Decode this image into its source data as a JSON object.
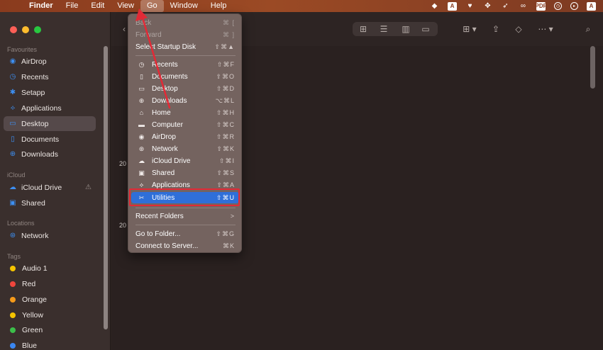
{
  "menubar": {
    "apple": "",
    "items": [
      "Finder",
      "File",
      "Edit",
      "View",
      "Go",
      "Window",
      "Help"
    ],
    "active_item": "Go",
    "tray": [
      "bird-icon",
      "A",
      "heart-icon",
      "shuffle-icon",
      "send-icon",
      "binoculars-icon",
      "PDF",
      "clock-icon",
      "play-icon",
      "A"
    ]
  },
  "sidebar": {
    "favourites_label": "Favourites",
    "favourites": [
      {
        "label": "AirDrop",
        "icon": "airdrop-icon"
      },
      {
        "label": "Recents",
        "icon": "clock-icon"
      },
      {
        "label": "Setapp",
        "icon": "setapp-icon"
      },
      {
        "label": "Applications",
        "icon": "applications-icon"
      },
      {
        "label": "Desktop",
        "icon": "desktop-icon",
        "selected": true
      },
      {
        "label": "Documents",
        "icon": "document-icon"
      },
      {
        "label": "Downloads",
        "icon": "download-icon"
      }
    ],
    "icloud_label": "iCloud",
    "icloud": [
      {
        "label": "iCloud Drive",
        "icon": "cloud-icon",
        "warning": "⚠"
      },
      {
        "label": "Shared",
        "icon": "shared-folder-icon"
      }
    ],
    "locations_label": "Locations",
    "locations": [
      {
        "label": "Network",
        "icon": "globe-icon"
      }
    ],
    "tags_label": "Tags",
    "tags": [
      {
        "label": "Audio 1",
        "color": "#f5c400"
      },
      {
        "label": "Red",
        "color": "#f0463d"
      },
      {
        "label": "Orange",
        "color": "#f59a1a"
      },
      {
        "label": "Yellow",
        "color": "#f5c400"
      },
      {
        "label": "Green",
        "color": "#3cbf4a"
      },
      {
        "label": "Blue",
        "color": "#3a86f0"
      }
    ]
  },
  "main": {
    "stubs": [
      "20",
      "20"
    ]
  },
  "go_menu": {
    "items": [
      {
        "label": "Back",
        "shortcut": "⌘ [",
        "disabled": true
      },
      {
        "label": "Forward",
        "shortcut": "⌘ ]",
        "disabled": true
      },
      {
        "label": "Select Startup Disk",
        "shortcut": "⇧⌘▲"
      },
      {
        "label": "Recents",
        "shortcut": "⇧⌘F",
        "icon": "clock-icon"
      },
      {
        "label": "Documents",
        "shortcut": "⇧⌘O",
        "icon": "document-icon"
      },
      {
        "label": "Desktop",
        "shortcut": "⇧⌘D",
        "icon": "desktop-icon"
      },
      {
        "label": "Downloads",
        "shortcut": "⌥⌘L",
        "icon": "download-icon"
      },
      {
        "label": "Home",
        "shortcut": "⇧⌘H",
        "icon": "home-icon"
      },
      {
        "label": "Computer",
        "shortcut": "⇧⌘C",
        "icon": "laptop-icon"
      },
      {
        "label": "AirDrop",
        "shortcut": "⇧⌘R",
        "icon": "airdrop-icon"
      },
      {
        "label": "Network",
        "shortcut": "⇧⌘K",
        "icon": "globe-icon"
      },
      {
        "label": "iCloud Drive",
        "shortcut": "⇧⌘I",
        "icon": "cloud-icon"
      },
      {
        "label": "Shared",
        "shortcut": "⇧⌘S",
        "icon": "shared-folder-icon"
      },
      {
        "label": "Applications",
        "shortcut": "⇧⌘A",
        "icon": "applications-icon"
      },
      {
        "label": "Utilities",
        "shortcut": "⇧⌘U",
        "icon": "utilities-icon",
        "highlighted": true
      },
      {
        "label": "Recent Folders",
        "shortcut": ">"
      },
      {
        "label": "Go to Folder...",
        "shortcut": "⇧⌘G"
      },
      {
        "label": "Connect to Server...",
        "shortcut": "⌘K"
      }
    ]
  },
  "colors": {
    "highlight": "#2f6fd8",
    "annotation_red": "#e22a36",
    "sidebar_accent": "#3d8ff2"
  }
}
